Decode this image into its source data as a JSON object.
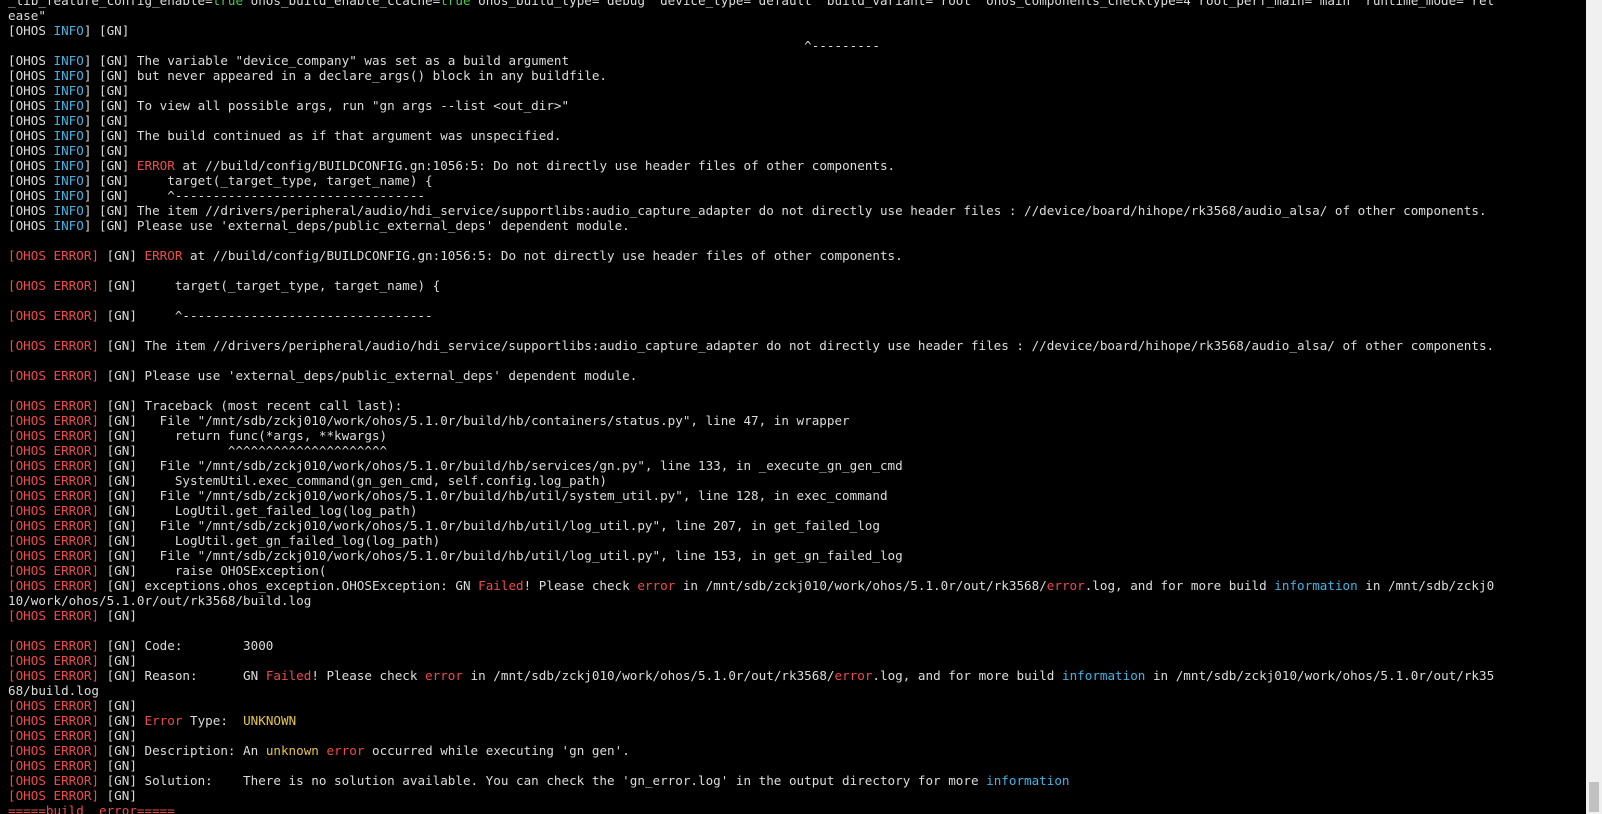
{
  "terminal": {
    "colors": {
      "background": "#000000",
      "text": "#dcdcdc",
      "green": "#4ec94e",
      "cyan": "#3fb5e6",
      "red": "#ee4b4b",
      "yellow": "#e5c54a"
    },
    "lines": [
      [
        [
          "w",
          "_lib_feature_config_enable="
        ],
        [
          "g",
          "true"
        ],
        [
          "w",
          " ohos_build_enable_ccache="
        ],
        [
          "g",
          "true"
        ],
        [
          "w",
          " ohos_build_type=\"debug\" device_type=\"default\" build_variant=\"root\" ohos_components_checktype=4 root_perf_main=\"main\" runtime_mode=\"rel"
        ]
      ],
      [
        [
          "w",
          "ease\""
        ]
      ],
      [
        [
          "w",
          "[OHOS "
        ],
        [
          "c",
          "INFO"
        ],
        [
          "w",
          "] [GN]"
        ]
      ],
      [
        [
          "w",
          "                                                                                                         ^---------"
        ]
      ],
      [
        [
          "w",
          "[OHOS "
        ],
        [
          "c",
          "INFO"
        ],
        [
          "w",
          "] [GN] The variable \"device_company\" was set as a build argument"
        ]
      ],
      [
        [
          "w",
          "[OHOS "
        ],
        [
          "c",
          "INFO"
        ],
        [
          "w",
          "] [GN] but never appeared in a declare_args() block in any buildfile."
        ]
      ],
      [
        [
          "w",
          "[OHOS "
        ],
        [
          "c",
          "INFO"
        ],
        [
          "w",
          "] [GN]"
        ]
      ],
      [
        [
          "w",
          "[OHOS "
        ],
        [
          "c",
          "INFO"
        ],
        [
          "w",
          "] [GN] To view all possible args, run \"gn args --list <out_dir>\""
        ]
      ],
      [
        [
          "w",
          "[OHOS "
        ],
        [
          "c",
          "INFO"
        ],
        [
          "w",
          "] [GN]"
        ]
      ],
      [
        [
          "w",
          "[OHOS "
        ],
        [
          "c",
          "INFO"
        ],
        [
          "w",
          "] [GN] The build continued as if that argument was unspecified."
        ]
      ],
      [
        [
          "w",
          "[OHOS "
        ],
        [
          "c",
          "INFO"
        ],
        [
          "w",
          "] [GN]"
        ]
      ],
      [
        [
          "w",
          "[OHOS "
        ],
        [
          "c",
          "INFO"
        ],
        [
          "w",
          "] [GN] "
        ],
        [
          "r",
          "ERROR"
        ],
        [
          "w",
          " at //build/config/BUILDCONFIG.gn:1056:5: Do not directly use header files of other components."
        ]
      ],
      [
        [
          "w",
          "[OHOS "
        ],
        [
          "c",
          "INFO"
        ],
        [
          "w",
          "] [GN]     target(_target_type, target_name) {"
        ]
      ],
      [
        [
          "w",
          "[OHOS "
        ],
        [
          "c",
          "INFO"
        ],
        [
          "w",
          "] [GN]     ^---------------------------------"
        ]
      ],
      [
        [
          "w",
          "[OHOS "
        ],
        [
          "c",
          "INFO"
        ],
        [
          "w",
          "] [GN] The item //drivers/peripheral/audio/hdi_service/supportlibs:audio_capture_adapter do not directly use header files : //device/board/hihope/rk3568/audio_alsa/ of other components."
        ]
      ],
      [
        [
          "w",
          "[OHOS "
        ],
        [
          "c",
          "INFO"
        ],
        [
          "w",
          "] [GN] Please use 'external_deps/public_external_deps' dependent module."
        ]
      ],
      [
        [
          "w",
          ""
        ]
      ],
      [
        [
          "r",
          "[OHOS ERROR]"
        ],
        [
          "w",
          " [GN] "
        ],
        [
          "r",
          "ERROR"
        ],
        [
          "w",
          " at //build/config/BUILDCONFIG.gn:1056:5: Do not directly use header files of other components."
        ]
      ],
      [
        [
          "w",
          ""
        ]
      ],
      [
        [
          "r",
          "[OHOS ERROR]"
        ],
        [
          "w",
          " [GN]     target(_target_type, target_name) {"
        ]
      ],
      [
        [
          "w",
          ""
        ]
      ],
      [
        [
          "r",
          "[OHOS ERROR]"
        ],
        [
          "w",
          " [GN]     ^---------------------------------"
        ]
      ],
      [
        [
          "w",
          ""
        ]
      ],
      [
        [
          "r",
          "[OHOS ERROR]"
        ],
        [
          "w",
          " [GN] The item //drivers/peripheral/audio/hdi_service/supportlibs:audio_capture_adapter do not directly use header files : //device/board/hihope/rk3568/audio_alsa/ of other components."
        ]
      ],
      [
        [
          "w",
          ""
        ]
      ],
      [
        [
          "r",
          "[OHOS ERROR]"
        ],
        [
          "w",
          " [GN] Please use 'external_deps/public_external_deps' dependent module."
        ]
      ],
      [
        [
          "w",
          ""
        ]
      ],
      [
        [
          "r",
          "[OHOS ERROR]"
        ],
        [
          "w",
          " [GN] Traceback (most recent call last):"
        ]
      ],
      [
        [
          "r",
          "[OHOS ERROR]"
        ],
        [
          "w",
          " [GN]   File \"/mnt/sdb/zckj010/work/ohos/5.1.0r/build/hb/containers/status.py\", line 47, in wrapper"
        ]
      ],
      [
        [
          "r",
          "[OHOS ERROR]"
        ],
        [
          "w",
          " [GN]     return func(*args, **kwargs)"
        ]
      ],
      [
        [
          "r",
          "[OHOS ERROR]"
        ],
        [
          "w",
          " [GN]            ^^^^^^^^^^^^^^^^^^^^^"
        ]
      ],
      [
        [
          "r",
          "[OHOS ERROR]"
        ],
        [
          "w",
          " [GN]   File \"/mnt/sdb/zckj010/work/ohos/5.1.0r/build/hb/services/gn.py\", line 133, in _execute_gn_gen_cmd"
        ]
      ],
      [
        [
          "r",
          "[OHOS ERROR]"
        ],
        [
          "w",
          " [GN]     SystemUtil.exec_command(gn_gen_cmd, self.config.log_path)"
        ]
      ],
      [
        [
          "r",
          "[OHOS ERROR]"
        ],
        [
          "w",
          " [GN]   File \"/mnt/sdb/zckj010/work/ohos/5.1.0r/build/hb/util/system_util.py\", line 128, in exec_command"
        ]
      ],
      [
        [
          "r",
          "[OHOS ERROR]"
        ],
        [
          "w",
          " [GN]     LogUtil.get_failed_log(log_path)"
        ]
      ],
      [
        [
          "r",
          "[OHOS ERROR]"
        ],
        [
          "w",
          " [GN]   File \"/mnt/sdb/zckj010/work/ohos/5.1.0r/build/hb/util/log_util.py\", line 207, in get_failed_log"
        ]
      ],
      [
        [
          "r",
          "[OHOS ERROR]"
        ],
        [
          "w",
          " [GN]     LogUtil.get_gn_failed_log(log_path)"
        ]
      ],
      [
        [
          "r",
          "[OHOS ERROR]"
        ],
        [
          "w",
          " [GN]   File \"/mnt/sdb/zckj010/work/ohos/5.1.0r/build/hb/util/log_util.py\", line 153, in get_gn_failed_log"
        ]
      ],
      [
        [
          "r",
          "[OHOS ERROR]"
        ],
        [
          "w",
          " [GN]     raise OHOSException("
        ]
      ],
      [
        [
          "r",
          "[OHOS ERROR]"
        ],
        [
          "w",
          " [GN] exceptions.ohos_exception.OHOSException: GN "
        ],
        [
          "r",
          "Failed"
        ],
        [
          "w",
          "! Please check "
        ],
        [
          "r",
          "error"
        ],
        [
          "w",
          " in /mnt/sdb/zckj010/work/ohos/5.1.0r/out/rk3568/"
        ],
        [
          "r",
          "error"
        ],
        [
          "w",
          ".log, and for more build "
        ],
        [
          "c",
          "information"
        ],
        [
          "w",
          " in /mnt/sdb/zckj0"
        ]
      ],
      [
        [
          "w",
          "10/work/ohos/5.1.0r/out/rk3568/build.log"
        ]
      ],
      [
        [
          "r",
          "[OHOS ERROR]"
        ],
        [
          "w",
          " [GN]"
        ]
      ],
      [
        [
          "w",
          ""
        ]
      ],
      [
        [
          "r",
          "[OHOS ERROR]"
        ],
        [
          "w",
          " [GN] Code:        3000"
        ]
      ],
      [
        [
          "r",
          "[OHOS ERROR]"
        ],
        [
          "w",
          " [GN]"
        ]
      ],
      [
        [
          "r",
          "[OHOS ERROR]"
        ],
        [
          "w",
          " [GN] Reason:      GN "
        ],
        [
          "r",
          "Failed"
        ],
        [
          "w",
          "! Please check "
        ],
        [
          "r",
          "error"
        ],
        [
          "w",
          " in /mnt/sdb/zckj010/work/ohos/5.1.0r/out/rk3568/"
        ],
        [
          "r",
          "error"
        ],
        [
          "w",
          ".log, and for more build "
        ],
        [
          "c",
          "information"
        ],
        [
          "w",
          " in /mnt/sdb/zckj010/work/ohos/5.1.0r/out/rk35"
        ]
      ],
      [
        [
          "w",
          "68/build.log"
        ]
      ],
      [
        [
          "r",
          "[OHOS ERROR]"
        ],
        [
          "w",
          " [GN]"
        ]
      ],
      [
        [
          "r",
          "[OHOS ERROR]"
        ],
        [
          "w",
          " [GN] "
        ],
        [
          "r",
          "Error"
        ],
        [
          "w",
          " Type:  "
        ],
        [
          "y",
          "UNKNOWN"
        ]
      ],
      [
        [
          "r",
          "[OHOS ERROR]"
        ],
        [
          "w",
          " [GN]"
        ]
      ],
      [
        [
          "r",
          "[OHOS ERROR]"
        ],
        [
          "w",
          " [GN] Description: An "
        ],
        [
          "y",
          "unknown"
        ],
        [
          "w",
          " "
        ],
        [
          "r",
          "error"
        ],
        [
          "w",
          " occurred while executing 'gn gen'."
        ]
      ],
      [
        [
          "r",
          "[OHOS ERROR]"
        ],
        [
          "w",
          " [GN]"
        ]
      ],
      [
        [
          "r",
          "[OHOS ERROR]"
        ],
        [
          "w",
          " [GN] Solution:    There is no solution available. You can check the 'gn_error.log' in the output directory for more "
        ],
        [
          "c",
          "information"
        ]
      ],
      [
        [
          "r",
          "[OHOS ERROR]"
        ],
        [
          "w",
          " [GN]"
        ]
      ],
      [
        [
          "r",
          "=====build  error====="
        ]
      ]
    ]
  }
}
